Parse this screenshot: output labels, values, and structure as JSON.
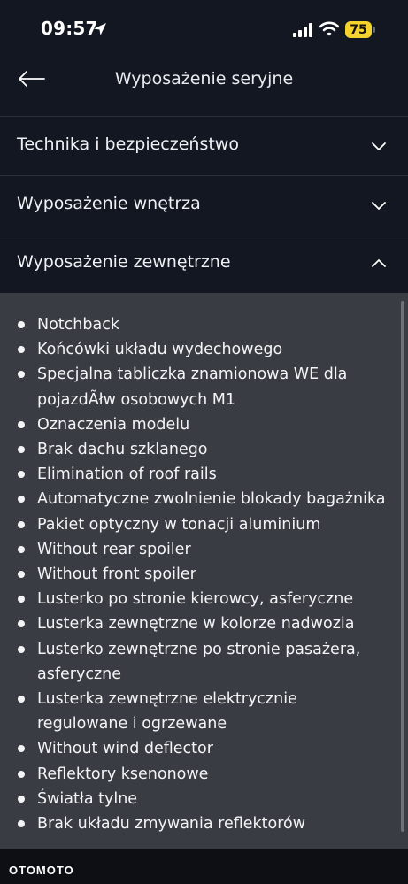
{
  "status_bar": {
    "time": "09:57",
    "battery": "75",
    "icons": [
      "location-arrow-icon",
      "signal-icon",
      "wifi-icon",
      "battery-icon"
    ]
  },
  "header": {
    "title": "Wyposażenie seryjne",
    "back_icon": "arrow-left-icon"
  },
  "sections": [
    {
      "label": "Technika i bezpieczeństwo",
      "expanded": false
    },
    {
      "label": "Wyposażenie wnętrza",
      "expanded": false
    },
    {
      "label": "Wyposażenie zewnętrzne",
      "expanded": true
    }
  ],
  "items": [
    "Notchback",
    "Końcówki układu wydechowego",
    "Specjalna tabliczka znamionowa WE dla pojazdÃłw osobowych M1",
    "Oznaczenia modelu",
    "Brak dachu szklanego",
    "Elimination of roof rails",
    "Automatyczne zwolnienie blokady bagażnika",
    "Pakiet optyczny w tonacji aluminium",
    "Without rear spoiler",
    "Without front spoiler",
    "Lusterko po stronie kierowcy, asferyczne",
    "Lusterka zewnętrzne w kolorze nadwozia",
    "Lusterko zewnętrzne po stronie pasażera, asferyczne",
    "Lusterka zewnętrzne elektrycznie regulowane i ogrzewane",
    "Without wind deflector",
    "Reflektory ksenonowe",
    "Światła tylne",
    "Brak układu zmywania reflektorów"
  ],
  "footer": {
    "logo": "OTOMOTO"
  },
  "colors": {
    "background": "#131722",
    "panel": "#393c43",
    "battery": "#f4d32c"
  }
}
